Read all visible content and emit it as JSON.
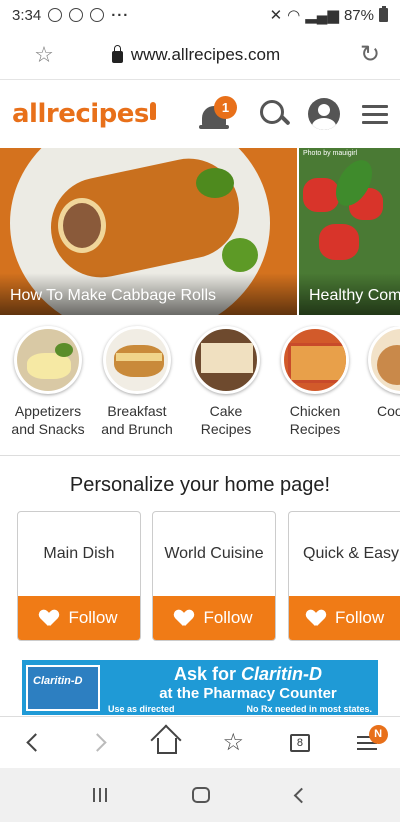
{
  "status_bar": {
    "time": "3:34",
    "dots": "···",
    "battery": "87%"
  },
  "address_bar": {
    "url": "www.allrecipes.com"
  },
  "header": {
    "logo": "allrecipes",
    "notification_count": "1",
    "brand_color": "#e8701a"
  },
  "hero": {
    "slides": [
      {
        "caption": "How To Make Cabbage Rolls"
      },
      {
        "caption": "Healthy Com",
        "credit": "Photo by mauigirl"
      }
    ]
  },
  "categories": [
    {
      "label": "Appetizers and Snacks"
    },
    {
      "label": "Breakfast and Brunch"
    },
    {
      "label": "Cake Recipes"
    },
    {
      "label": "Chicken Recipes"
    },
    {
      "label": "Coo"
    }
  ],
  "personalize": {
    "title": "Personalize your home page!",
    "follow_label": "Follow",
    "topics": [
      {
        "name": "Main Dish"
      },
      {
        "name": "World Cuisine"
      },
      {
        "name": "Quick & Easy"
      }
    ]
  },
  "ad": {
    "box_label": "Claritin-D",
    "headline_prefix": "Ask for ",
    "headline_brand": "Claritin-D",
    "subline": "at the Pharmacy Counter",
    "footer_left": "Use as directed",
    "footer_right": "No Rx needed in most states."
  },
  "toolbar": {
    "tab_count": "8",
    "menu_badge": "N"
  },
  "colors": {
    "follow_orange": "#f07b16",
    "ad_blue": "#1f9ad6"
  }
}
